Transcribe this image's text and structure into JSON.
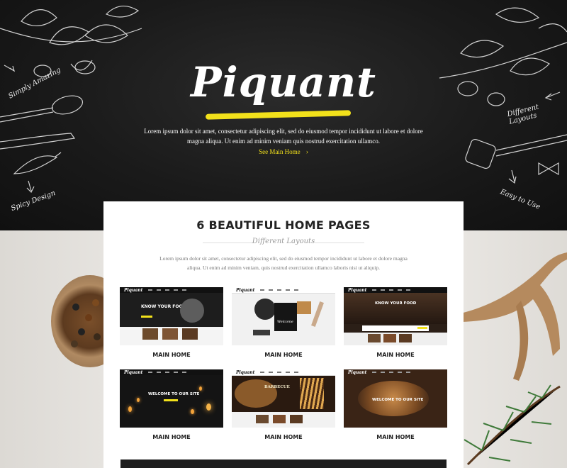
{
  "hero": {
    "logo": "Piquant",
    "description": "Lorem ipsum dolor sit amet, consectetur adipiscing elit, sed do eiusmod tempor incididunt ut labore et dolore magna aliqua. Ut enim ad minim veniam quis nostrud exercitation ullamco.",
    "link_label": "See Main Home",
    "link_arrow": "›",
    "chalk_labels": [
      "Simply Amazing",
      "Spicy Design",
      "Different Layouts",
      "Easy to Use"
    ]
  },
  "section": {
    "title": "6 BEAUTIFUL HOME PAGES",
    "subtitle": "Different Layouts",
    "description": "Lorem ipsum dolor sit amet, consectetur adipiscing elit, sed do eiusmod tempor incididunt ut labore et dolore magna aliqua. Ut enim ad minim veniam, quis nostrud exercitation ullamco laboris nisi ut aliquip.",
    "pages": [
      {
        "label": "MAIN HOME",
        "heading": "KNOW YOUR FOOD",
        "logo": "Piquant"
      },
      {
        "label": "MAIN HOME",
        "heading": "Welcome",
        "logo": "Piquant"
      },
      {
        "label": "MAIN HOME",
        "heading": "KNOW YOUR FOOD",
        "logo": "Piquant"
      },
      {
        "label": "MAIN HOME",
        "heading": "WELCOME TO OUR SITE",
        "logo": "Piquant"
      },
      {
        "label": "MAIN HOME",
        "heading": "BARBECUE",
        "logo": "Piquant"
      },
      {
        "label": "MAIN HOME",
        "heading": "WELCOME TO OUR SITE",
        "logo": "Piquant"
      }
    ]
  },
  "colors": {
    "accent": "#f2e11b",
    "hero_bg": "#1a1a1a",
    "card_bg": "#ffffff"
  }
}
